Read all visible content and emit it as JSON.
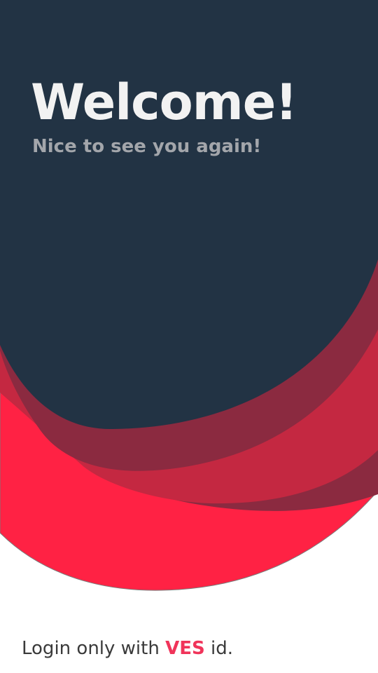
{
  "welcome": {
    "title": "Welcome!",
    "subtitle": "Nice to see you again!"
  },
  "login_note": {
    "prefix": "Login only with ",
    "brand": "VES",
    "suffix": " id."
  },
  "colors": {
    "navy": "#223344",
    "brand_red": "#ff2244",
    "mid_red": "#c42841",
    "dark_red": "#8b2a40",
    "brand_text": "#f0345a"
  }
}
